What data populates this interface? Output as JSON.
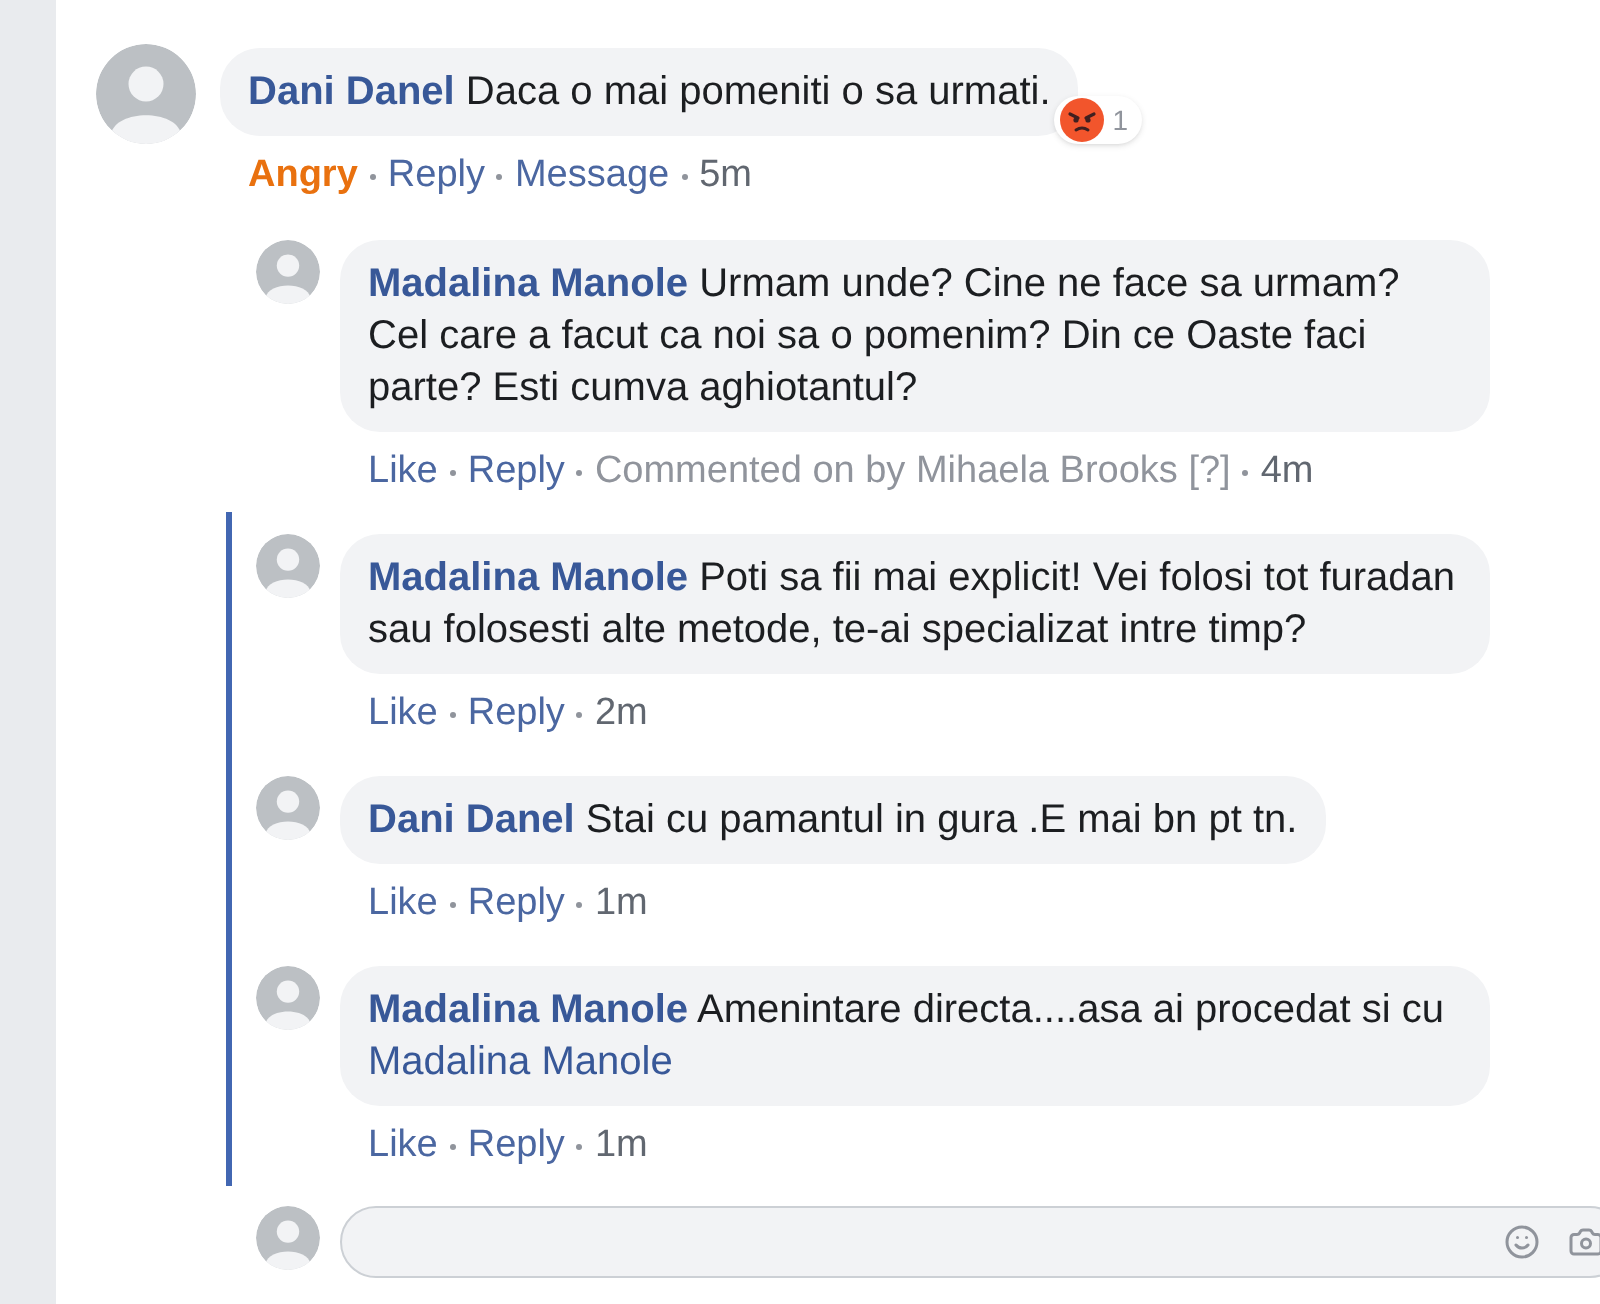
{
  "comment": {
    "author": "Dani Danel",
    "text": "Daca o mai pomeniti o sa urmati.",
    "reaction": {
      "kind": "angry",
      "count": "1"
    },
    "actions": [
      {
        "text": "Angry",
        "kind": "reaction"
      },
      {
        "text": "Reply",
        "kind": "link"
      },
      {
        "text": "Message",
        "kind": "link"
      },
      {
        "text": "5m",
        "kind": "time"
      }
    ]
  },
  "replies": [
    {
      "author": "Madalina Manole",
      "text": "Urmam unde? Cine ne face sa urmam? Cel care a facut ca noi sa o pomenim? Din ce Oaste faci parte? Esti cumva aghiotantul?",
      "marked": false,
      "actions": [
        {
          "text": "Like",
          "kind": "link"
        },
        {
          "text": "Reply",
          "kind": "link"
        },
        {
          "text": "Commented on by Mihaela Brooks [?]",
          "kind": "meta"
        },
        {
          "text": "4m",
          "kind": "time"
        }
      ]
    },
    {
      "author": "Madalina Manole",
      "text": "Poti sa fii mai explicit! Vei folosi tot furadan sau folosesti alte metode, te-ai specializat intre timp?",
      "marked": true,
      "actions": [
        {
          "text": "Like",
          "kind": "link"
        },
        {
          "text": "Reply",
          "kind": "link"
        },
        {
          "text": "2m",
          "kind": "time"
        }
      ]
    },
    {
      "author": "Dani Danel",
      "text": "Stai cu pamantul in gura .E mai bn pt tn.",
      "marked": true,
      "actions": [
        {
          "text": "Like",
          "kind": "link"
        },
        {
          "text": "Reply",
          "kind": "link"
        },
        {
          "text": "1m",
          "kind": "time"
        }
      ]
    },
    {
      "author": "Madalina Manole",
      "text": "Amenintare directa....asa ai procedat si cu",
      "mention": "Madalina Manole",
      "marked": true,
      "actions": [
        {
          "text": "Like",
          "kind": "link"
        },
        {
          "text": "Reply",
          "kind": "link"
        },
        {
          "text": "1m",
          "kind": "time"
        }
      ]
    }
  ]
}
